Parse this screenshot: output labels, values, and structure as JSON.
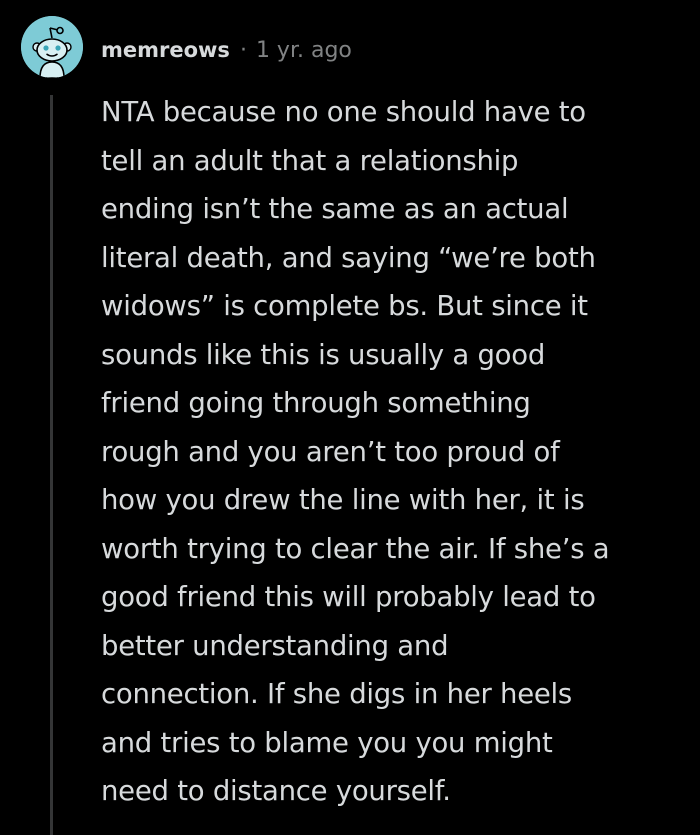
{
  "comment": {
    "avatar_icon": "snoo-avatar-icon",
    "avatar_color": "#7ecbd6",
    "username": "memreows",
    "separator": "·",
    "timestamp": "1 yr. ago",
    "body_lines": [
      "NTA because no one should have to",
      "tell an adult that a relationship",
      "ending isn’t the same as an actual",
      "literal death, and saying “we’re both",
      "widows” is complete bs. But since it",
      "sounds like this is usually a good",
      "friend going through something",
      "rough and you aren’t too proud of",
      "how you drew the line with her, it is",
      "worth trying to clear the air. If she’s a",
      "good friend this will probably lead to",
      "better understanding and",
      "connection. If she digs in her heels",
      "and tries to blame you you might",
      "need to distance yourself."
    ]
  }
}
